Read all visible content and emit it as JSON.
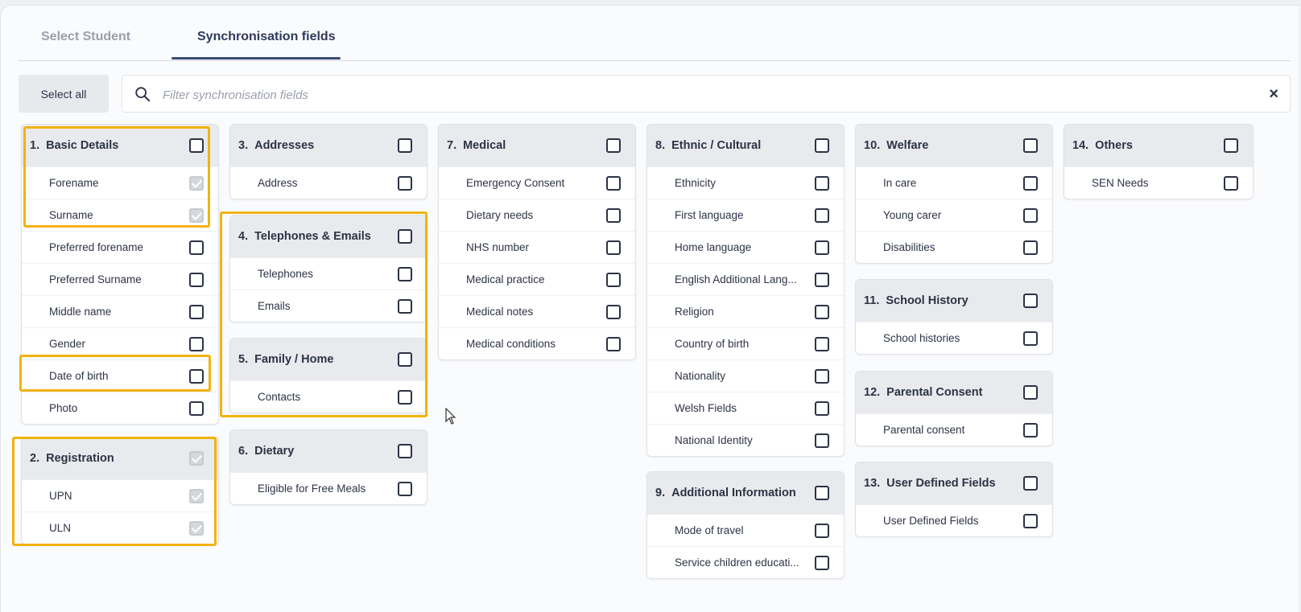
{
  "tabs": [
    {
      "label": "Select Student",
      "active": false
    },
    {
      "label": "Synchronisation fields",
      "active": true
    }
  ],
  "toolbar": {
    "select_all_label": "Select all",
    "filter_placeholder": "Filter synchronisation fields",
    "clear_symbol": "×"
  },
  "accent_color": "#3b4b78",
  "highlight_color": "#f2b30e",
  "sections": {
    "s1": {
      "num": "1.",
      "title": "Basic Details",
      "checked": false,
      "fields": [
        {
          "label": "Forename",
          "checked": true
        },
        {
          "label": "Surname",
          "checked": true
        },
        {
          "label": "Preferred forename",
          "checked": false
        },
        {
          "label": "Preferred Surname",
          "checked": false
        },
        {
          "label": "Middle name",
          "checked": false
        },
        {
          "label": "Gender",
          "checked": false
        },
        {
          "label": "Date of birth",
          "checked": false
        },
        {
          "label": "Photo",
          "checked": false
        }
      ]
    },
    "s2": {
      "num": "2.",
      "title": "Registration",
      "checked": true,
      "fields": [
        {
          "label": "UPN",
          "checked": true
        },
        {
          "label": "ULN",
          "checked": true
        }
      ]
    },
    "s3": {
      "num": "3.",
      "title": "Addresses",
      "checked": false,
      "fields": [
        {
          "label": "Address",
          "checked": false
        }
      ]
    },
    "s4": {
      "num": "4.",
      "title": "Telephones & Emails",
      "checked": false,
      "fields": [
        {
          "label": "Telephones",
          "checked": false
        },
        {
          "label": "Emails",
          "checked": false
        }
      ]
    },
    "s5": {
      "num": "5.",
      "title": "Family / Home",
      "checked": false,
      "fields": [
        {
          "label": "Contacts",
          "checked": false
        }
      ]
    },
    "s6": {
      "num": "6.",
      "title": "Dietary",
      "checked": false,
      "fields": [
        {
          "label": "Eligible for Free Meals",
          "checked": false
        }
      ]
    },
    "s7": {
      "num": "7.",
      "title": "Medical",
      "checked": false,
      "fields": [
        {
          "label": "Emergency Consent",
          "checked": false
        },
        {
          "label": "Dietary needs",
          "checked": false
        },
        {
          "label": "NHS number",
          "checked": false
        },
        {
          "label": "Medical practice",
          "checked": false
        },
        {
          "label": "Medical notes",
          "checked": false
        },
        {
          "label": "Medical conditions",
          "checked": false
        }
      ]
    },
    "s8": {
      "num": "8.",
      "title": "Ethnic / Cultural",
      "checked": false,
      "fields": [
        {
          "label": "Ethnicity",
          "checked": false
        },
        {
          "label": "First language",
          "checked": false
        },
        {
          "label": "Home language",
          "checked": false
        },
        {
          "label": "English Additional Lang...",
          "checked": false
        },
        {
          "label": "Religion",
          "checked": false
        },
        {
          "label": "Country of birth",
          "checked": false
        },
        {
          "label": "Nationality",
          "checked": false
        },
        {
          "label": "Welsh Fields",
          "checked": false
        },
        {
          "label": "National Identity",
          "checked": false
        }
      ]
    },
    "s9": {
      "num": "9.",
      "title": "Additional Information",
      "checked": false,
      "fields": [
        {
          "label": "Mode of travel",
          "checked": false
        },
        {
          "label": "Service children educati...",
          "checked": false
        }
      ]
    },
    "s10": {
      "num": "10.",
      "title": "Welfare",
      "checked": false,
      "fields": [
        {
          "label": "In care",
          "checked": false
        },
        {
          "label": "Young carer",
          "checked": false
        },
        {
          "label": "Disabilities",
          "checked": false
        }
      ]
    },
    "s11": {
      "num": "11.",
      "title": "School History",
      "checked": false,
      "fields": [
        {
          "label": "School histories",
          "checked": false
        }
      ]
    },
    "s12": {
      "num": "12.",
      "title": "Parental Consent",
      "checked": false,
      "fields": [
        {
          "label": "Parental consent",
          "checked": false
        }
      ]
    },
    "s13": {
      "num": "13.",
      "title": "User Defined Fields",
      "checked": false,
      "fields": [
        {
          "label": "User Defined Fields",
          "checked": false
        }
      ]
    },
    "s14": {
      "num": "14.",
      "title": "Others",
      "checked": false,
      "fields": [
        {
          "label": "SEN Needs",
          "checked": false
        }
      ]
    }
  }
}
